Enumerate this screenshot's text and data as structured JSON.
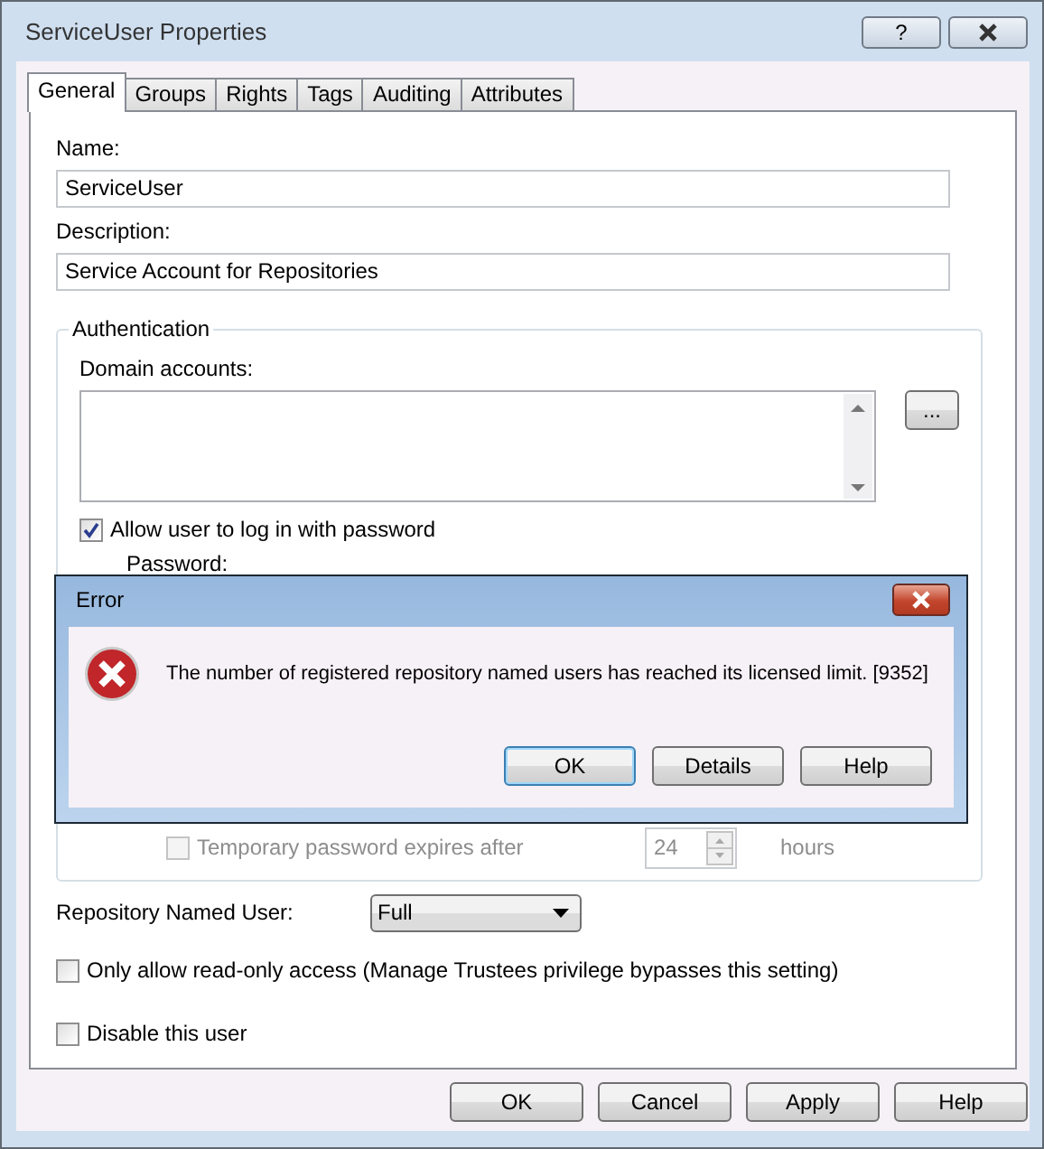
{
  "window": {
    "title": "ServiceUser Properties",
    "help_button": "?"
  },
  "tabs": [
    {
      "label": "General",
      "selected": true
    },
    {
      "label": "Groups",
      "selected": false
    },
    {
      "label": "Rights",
      "selected": false
    },
    {
      "label": "Tags",
      "selected": false
    },
    {
      "label": "Auditing",
      "selected": false
    },
    {
      "label": "Attributes",
      "selected": false
    }
  ],
  "name": {
    "label": "Name:",
    "value": "ServiceUser"
  },
  "description": {
    "label": "Description:",
    "value": "Service Account for Repositories"
  },
  "authentication": {
    "title": "Authentication",
    "domain_accounts_label": "Domain accounts:",
    "browse_button": "...",
    "allow_password": {
      "label": "Allow user to log in with password",
      "checked": true,
      "disabled": false
    },
    "password_label": "Password:",
    "temporary_expiry": {
      "label": "Temporary password expires after",
      "checked": false,
      "disabled": true,
      "value": "24",
      "unit": "hours"
    }
  },
  "repository_named_user": {
    "label": "Repository Named User:",
    "value": "Full"
  },
  "options": [
    {
      "label": "Only allow read-only access (Manage Trustees privilege bypasses this setting)",
      "checked": false,
      "disabled": false
    },
    {
      "label": "Disable this user",
      "checked": false,
      "disabled": false
    }
  ],
  "buttons": [
    {
      "label": "OK",
      "default": false
    },
    {
      "label": "Cancel",
      "default": false
    },
    {
      "label": "Apply",
      "default": false
    },
    {
      "label": "Help",
      "default": false
    }
  ],
  "error_dialog": {
    "title": "Error",
    "message": "The number of registered repository named users has reached its licensed limit. [9352]",
    "buttons": [
      {
        "label": "OK",
        "default": true
      },
      {
        "label": "Details",
        "default": false
      },
      {
        "label": "Help",
        "default": false
      }
    ]
  }
}
